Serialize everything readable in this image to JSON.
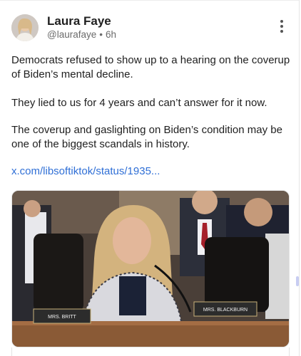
{
  "post": {
    "author_name": "Laura Faye",
    "handle": "@laurafaye",
    "separator": "•",
    "time_ago": "6h",
    "paragraphs": [
      "Democrats refused to show up to a hearing on the coverup of Biden’s mental decline.",
      "They lied to us for 4 years and can’t answer for it now.",
      "The coverup and gaslighting on Biden’s condition may be one of the biggest scandals in history."
    ],
    "link_text": "x.com/libsoftiktok/status/1935..."
  },
  "media": {
    "nameplate_left": "MRS. BRITT",
    "nameplate_right": "MRS. BLACKBURN"
  },
  "icons": {
    "menu": "more-vertical-icon",
    "avatar": "avatar"
  }
}
